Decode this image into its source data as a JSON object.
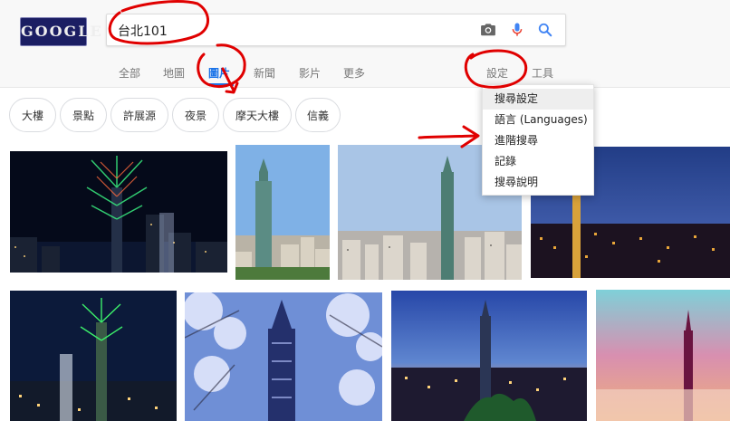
{
  "logo": {
    "text": "GOOGLE"
  },
  "search": {
    "value": "台北101",
    "camera_icon": "camera-icon",
    "mic_icon": "microphone-icon",
    "search_icon": "search-icon"
  },
  "tabs": [
    {
      "label": "全部"
    },
    {
      "label": "地圖"
    },
    {
      "label": "圖片",
      "active": true
    },
    {
      "label": "新聞"
    },
    {
      "label": "影片"
    },
    {
      "label": "更多"
    }
  ],
  "tools": {
    "settings": "設定",
    "tools": "工具"
  },
  "chips": [
    {
      "label": "大樓"
    },
    {
      "label": "景點"
    },
    {
      "label": "許展源"
    },
    {
      "label": "夜景"
    },
    {
      "label": "摩天大樓"
    },
    {
      "label": "信義"
    }
  ],
  "settings_menu": [
    {
      "label": "搜尋設定",
      "highlighted": true
    },
    {
      "label": "語言 (Languages)"
    },
    {
      "label": "進階搜尋"
    },
    {
      "label": "記錄"
    },
    {
      "label": "搜尋說明"
    }
  ],
  "colors": {
    "accent_blue": "#1a73e8",
    "annotation_red": "#e00000",
    "mic_red": "#ea4335"
  }
}
